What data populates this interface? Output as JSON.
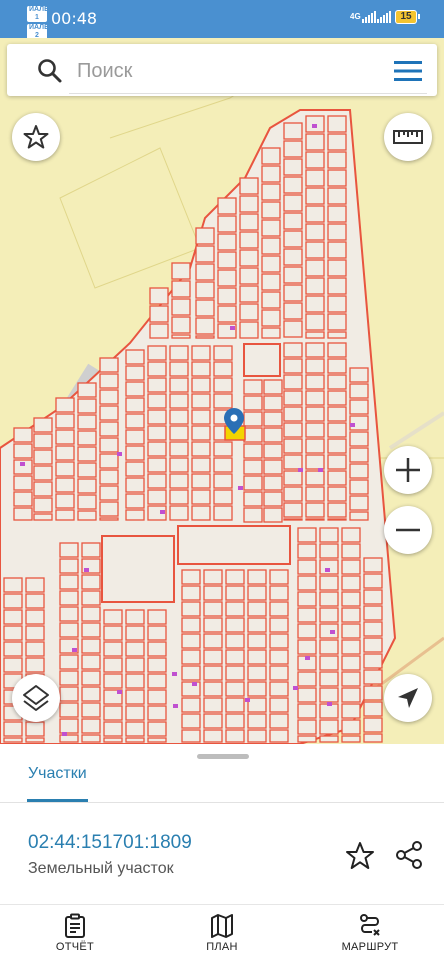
{
  "status_bar": {
    "sim1": "ИАЛЕ 1",
    "sim2": "ИАЛЕ 2",
    "time": "00:48",
    "network": "4G",
    "battery": "15"
  },
  "search": {
    "placeholder": "Поиск"
  },
  "map_controls": {
    "favorite": "star-icon",
    "ruler": "ruler-icon",
    "zoom_in": "plus-icon",
    "zoom_out": "minus-icon",
    "layers": "layers-icon",
    "locate": "navigation-arrow-icon"
  },
  "map": {
    "marker": "location-pin-icon",
    "colors": {
      "background": "#f4eeb8",
      "parcel_fill": "#f1ece4",
      "parcel_border": "#e8553f",
      "road": "#d8d8d8",
      "marker": "#2a6fb5",
      "highlight": "#f3d400",
      "point": "#c050d0"
    }
  },
  "panel": {
    "tab": "Участки",
    "parcel_number": "02:44:151701:1809",
    "parcel_type": "Земельный участок"
  },
  "bottom_nav": [
    {
      "label": "ОТЧЁТ",
      "icon": "report-icon"
    },
    {
      "label": "ПЛАН",
      "icon": "map-plan-icon"
    },
    {
      "label": "МАРШРУТ",
      "icon": "route-icon"
    }
  ]
}
